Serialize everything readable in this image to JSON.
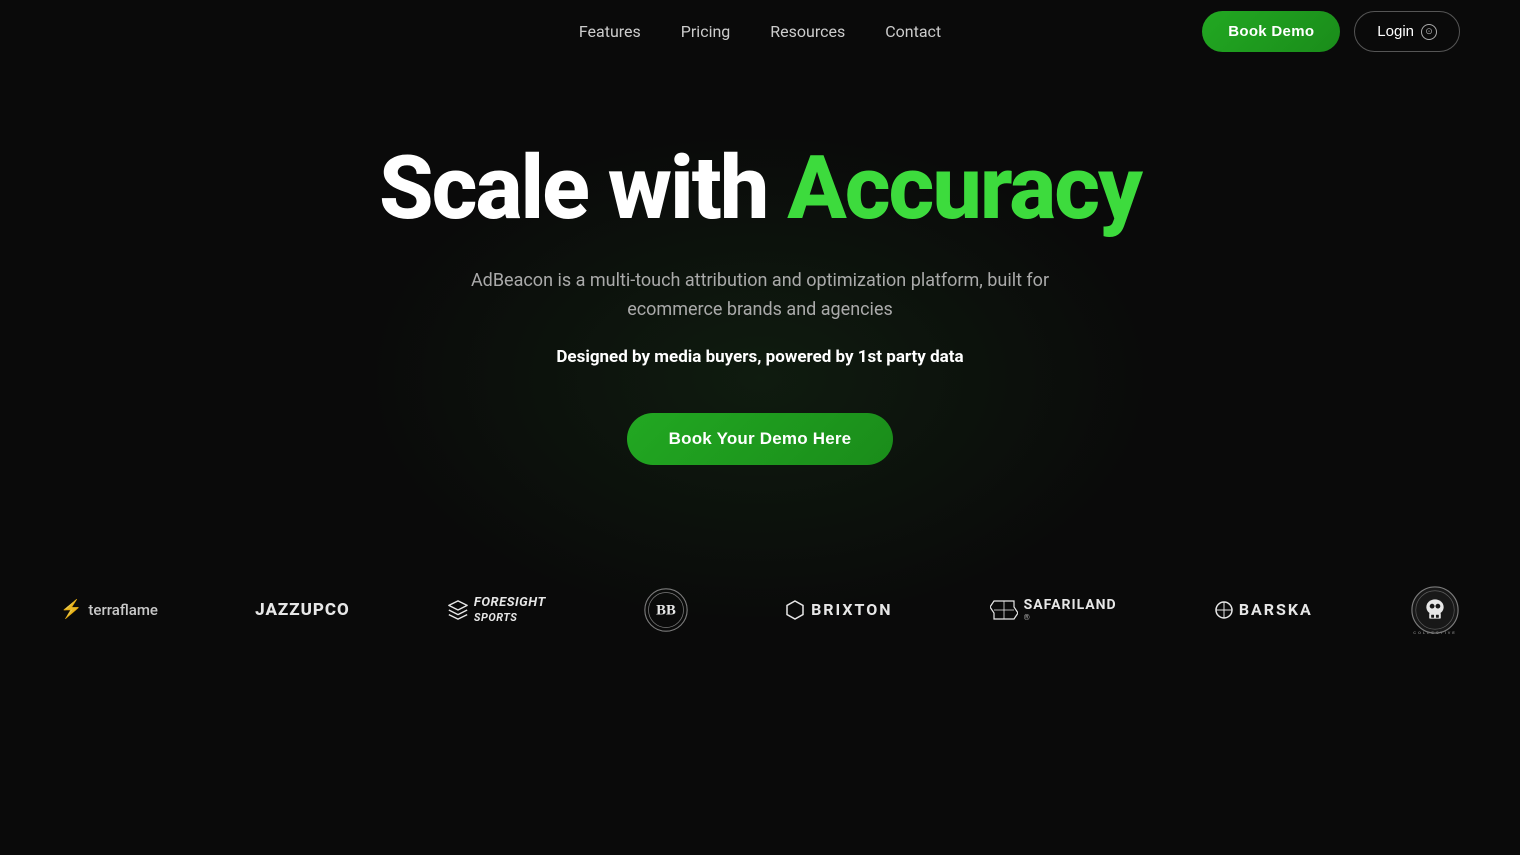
{
  "nav": {
    "links": [
      {
        "label": "Features",
        "id": "features"
      },
      {
        "label": "Pricing",
        "id": "pricing"
      },
      {
        "label": "Resources",
        "id": "resources"
      },
      {
        "label": "Contact",
        "id": "contact"
      }
    ],
    "book_demo_label": "Book Demo",
    "login_label": "Login"
  },
  "hero": {
    "title_part1": "Scale with ",
    "title_accent": "Accuracy",
    "subtitle": "AdBeacon is a multi-touch attribution and optimization platform, built for ecommerce brands and agencies",
    "tagline": "Designed by media buyers, powered by 1st party data",
    "cta_label": "Book Your Demo Here"
  },
  "logos": [
    {
      "id": "terraflame",
      "name": "terraflame",
      "text": "terraflame"
    },
    {
      "id": "jazzupco",
      "name": "JAZZUPCO",
      "text": "JAZZUPCO"
    },
    {
      "id": "foresight",
      "name": "FORESIGHT SPORTS",
      "text": "FORESIGHT SPORTS"
    },
    {
      "id": "bb",
      "name": "BB Badge",
      "text": ""
    },
    {
      "id": "brixton",
      "name": "BRIXTON",
      "text": "BRIXTON"
    },
    {
      "id": "safariland",
      "name": "SAFARILAND",
      "text": "SAFARILAND®"
    },
    {
      "id": "barska",
      "name": "BARSKA",
      "text": "BARSKA"
    },
    {
      "id": "skull",
      "name": "Skull Badge",
      "text": ""
    }
  ]
}
